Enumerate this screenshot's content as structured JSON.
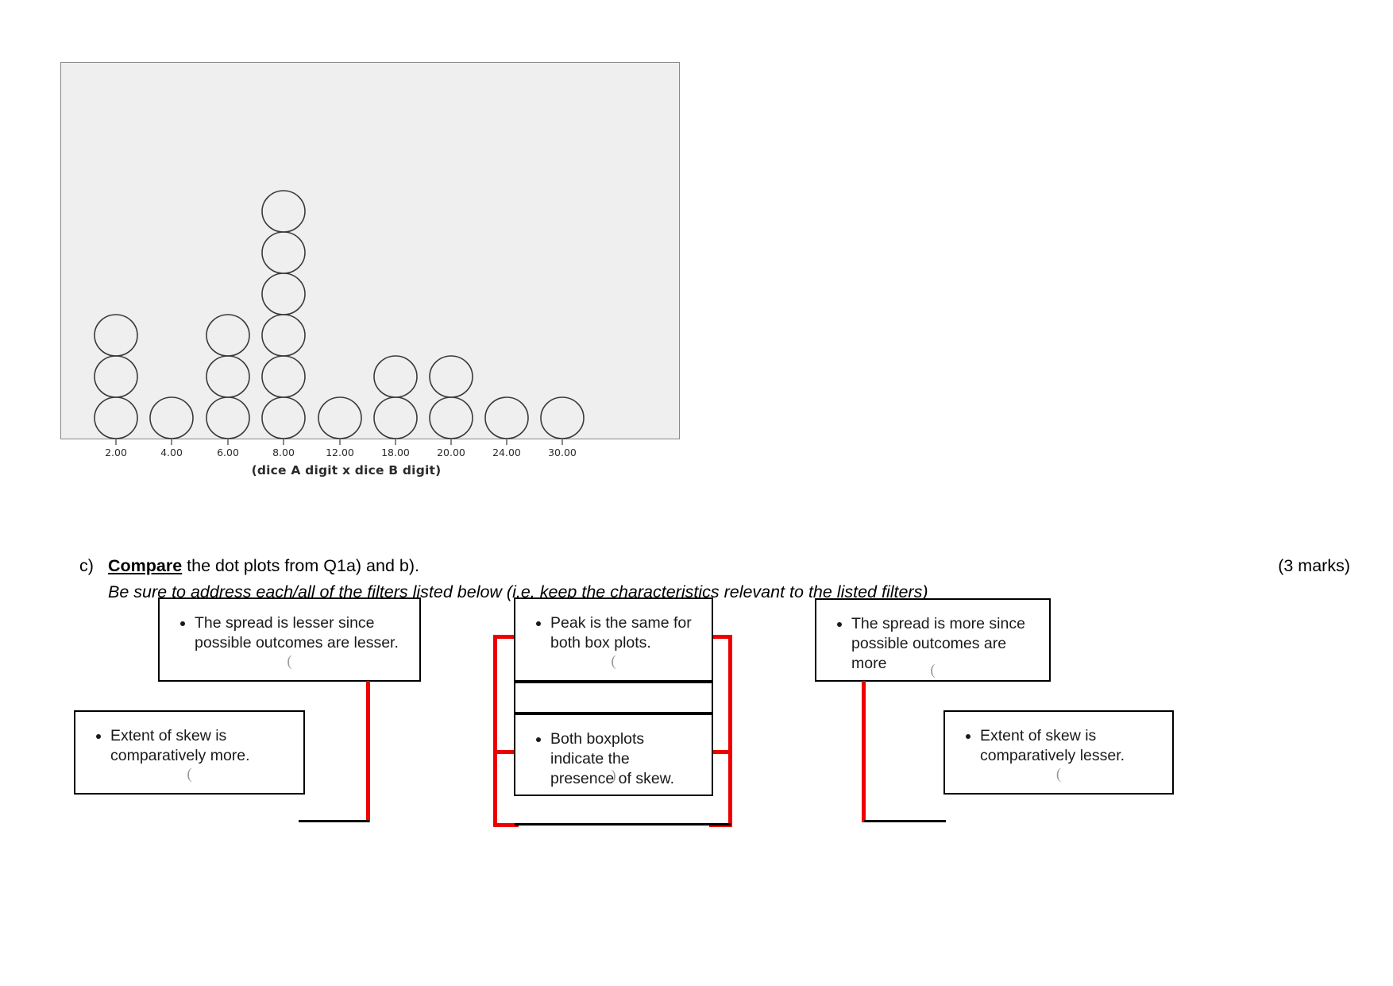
{
  "chart_data": {
    "type": "dot",
    "title": "",
    "xlabel": "(dice A digit x dice B digit)",
    "ylabel": "",
    "grid": false,
    "legend": null,
    "tick_labels": [
      "2.00",
      "4.00",
      "6.00",
      "8.00",
      "12.00",
      "18.00",
      "20.00",
      "24.00",
      "30.00"
    ],
    "categories": [
      2,
      4,
      6,
      8,
      12,
      18,
      20,
      24,
      30
    ],
    "values": [
      3,
      1,
      3,
      6,
      1,
      2,
      2,
      1,
      1
    ],
    "dot_shape": "open-circle",
    "plot_background": "#efefef",
    "dot_outline_color": "#3a3a3a"
  },
  "figure": {
    "axis_title": "(dice A digit x dice B digit)"
  },
  "question": {
    "marker": "c)",
    "strong_word": "Compare",
    "line1_rest": " the dot plots from Q1a) and b).",
    "marks": "(3 marks)",
    "line2": "Be sure to address each/all of the filters listed below (i.e. keep the characteristics relevant to the listed filters)"
  },
  "answers": {
    "left_group": {
      "box_top": {
        "bullet": "The spread is lesser since possible outcomes are lesser.",
        "paren": "("
      },
      "box_bottom": {
        "bullet": "Extent of skew is comparatively more.",
        "paren": "("
      }
    },
    "middle_group": {
      "box_top": {
        "bullet": "Peak is the same for both box plots.",
        "paren": "("
      },
      "box_bottom": {
        "bullet": "Both boxplots indicate the presence of skew.",
        "paren": ")"
      }
    },
    "right_group": {
      "box_top": {
        "bullet": "The spread is more since possible outcomes are more",
        "paren": "("
      },
      "box_bottom": {
        "bullet": "Extent of skew is comparatively lesser.",
        "paren": "("
      }
    }
  },
  "colors": {
    "connector_red": "#ee0000",
    "box_border": "#000000",
    "plot_bg": "#efefef",
    "frame_border": "#888888"
  }
}
